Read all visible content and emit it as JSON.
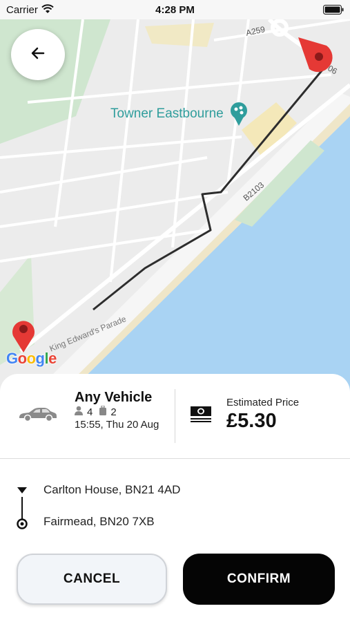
{
  "status_bar": {
    "carrier": "Carrier",
    "time": "4:28 PM"
  },
  "map": {
    "poi_label": "Towner Eastbourne",
    "road_labels": {
      "a259": "A259",
      "road_06": "06",
      "b2103": "B2103",
      "edwards_parade": "King Edward's Parade"
    },
    "logo_letters": [
      "G",
      "o",
      "o",
      "g",
      "l",
      "e"
    ],
    "colors": {
      "sea": "#a9d3f3",
      "route": "#2d2d2d",
      "marker": "#e53935",
      "park": "#cfe6cf",
      "poi": "#2f9d9c"
    }
  },
  "ride": {
    "vehicle_name": "Any Vehicle",
    "passengers": "4",
    "luggage": "2",
    "datetime": "15:55, Thu 20 Aug",
    "price_label": "Estimated Price",
    "price_value": "£5.30"
  },
  "route": {
    "pickup": "Carlton House, BN21 4AD",
    "dropoff": "Fairmead, BN20 7XB"
  },
  "actions": {
    "cancel_label": "CANCEL",
    "confirm_label": "CONFIRM"
  },
  "icons": [
    "wifi-icon",
    "battery-icon",
    "back-arrow-icon",
    "map-marker-icon",
    "car-icon",
    "person-icon",
    "luggage-icon",
    "cash-icon",
    "pickup-icon",
    "dropoff-icon",
    "poi-icon"
  ]
}
